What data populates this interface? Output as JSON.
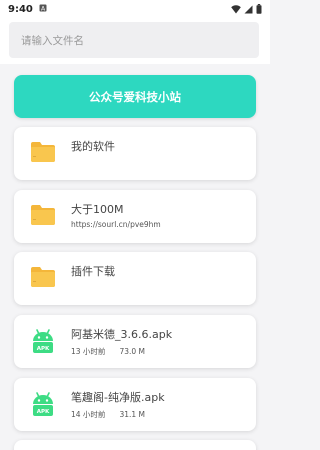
{
  "status_bar": {
    "time": "9:40"
  },
  "search": {
    "placeholder": "请输入文件名"
  },
  "banner_button": {
    "label": "公众号爱科技小站"
  },
  "items": [
    {
      "type": "folder",
      "title": "我的软件",
      "subtitle": ""
    },
    {
      "type": "folder",
      "title": "大于100M",
      "subtitle": "https://sourl.cn/pve9hm"
    },
    {
      "type": "folder",
      "title": "插件下载",
      "subtitle": ""
    },
    {
      "type": "apk",
      "title": "阿基米德_3.6.6.apk",
      "time": "13 小时前",
      "size": "73.0 M",
      "icon_text": "APK"
    },
    {
      "type": "apk",
      "title": "笔趣阁-纯净版.apk",
      "time": "14 小时前",
      "size": "31.1 M",
      "icon_text": "APK"
    }
  ],
  "colors": {
    "accent": "#2dd8c0",
    "folder": "#f9c64e",
    "apk": "#3ddc84"
  }
}
